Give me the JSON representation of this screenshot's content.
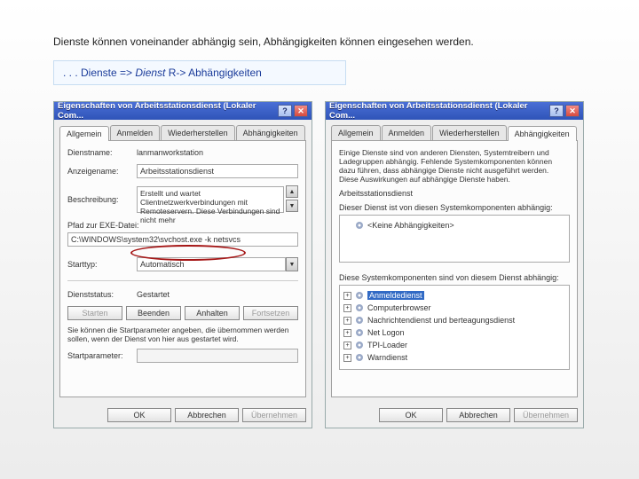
{
  "intro": "Dienste können voneinander abhängig sein, Abhängigkeiten können eingesehen werden.",
  "nav": {
    "prefix": ". . . Dienste => ",
    "italic": "Dienst",
    "suffix": " R-> Abhängigkeiten"
  },
  "dialogA": {
    "title": "Eigenschaften von Arbeitsstationsdienst (Lokaler Com...",
    "tabs": [
      "Allgemein",
      "Anmelden",
      "Wiederherstellen",
      "Abhängigkeiten"
    ],
    "activeTab": 0,
    "rows": {
      "dienstname_lbl": "Dienstname:",
      "dienstname_val": "lanmanworkstation",
      "anzeigename_lbl": "Anzeigename:",
      "anzeigename_val": "Arbeitsstationsdienst",
      "beschreibung_lbl": "Beschreibung:",
      "beschreibung_val": "Erstellt und wartet Clientnetzwerkverbindungen mit Remoteservern. Diese Verbindungen sind nicht mehr",
      "pfad_lbl": "Pfad zur EXE-Datei:",
      "pfad_val": "C:\\WINDOWS\\system32\\svchost.exe -k netsvcs",
      "starttyp_lbl": "Starttyp:",
      "starttyp_val": "Automatisch",
      "status_lbl": "Dienststatus:",
      "status_val": "Gestartet"
    },
    "buttons": {
      "starten": "Starten",
      "beenden": "Beenden",
      "anhalten": "Anhalten",
      "fortsetzen": "Fortsetzen"
    },
    "note": "Sie können die Startparameter angeben, die übernommen werden sollen, wenn der Dienst von hier aus gestartet wird.",
    "startparam_lbl": "Startparameter:",
    "footer": {
      "ok": "OK",
      "abbrechen": "Abbrechen",
      "uebernehmen": "Übernehmen"
    }
  },
  "dialogB": {
    "title": "Eigenschaften von Arbeitsstationsdienst (Lokaler Com...",
    "tabs": [
      "Allgemein",
      "Anmelden",
      "Wiederherstellen",
      "Abhängigkeiten"
    ],
    "activeTab": 3,
    "info": "Einige Dienste sind von anderen Diensten, Systemtreibern und Ladegruppen abhängig. Fehlende Systemkomponenten können dazu führen, dass abhängige Dienste nicht ausgeführt werden. Diese Auswirkungen auf abhängige Dienste haben.",
    "svc_lbl": "Arbeitsstationsdienst",
    "tree1_lbl": "Dieser Dienst ist von diesen Systemkomponenten abhängig:",
    "tree1_items": [
      "<Keine Abhängigkeiten>"
    ],
    "tree2_lbl": "Diese Systemkomponenten sind von diesem Dienst abhängig:",
    "tree2_items": [
      "Anmeldedienst",
      "Computerbrowser",
      "Nachrichtendienst und berteagungsdienst",
      "Net Logon",
      "TPI-Loader",
      "Warndienst"
    ],
    "footer": {
      "ok": "OK",
      "abbrechen": "Abbrechen",
      "uebernehmen": "Übernehmen"
    }
  }
}
